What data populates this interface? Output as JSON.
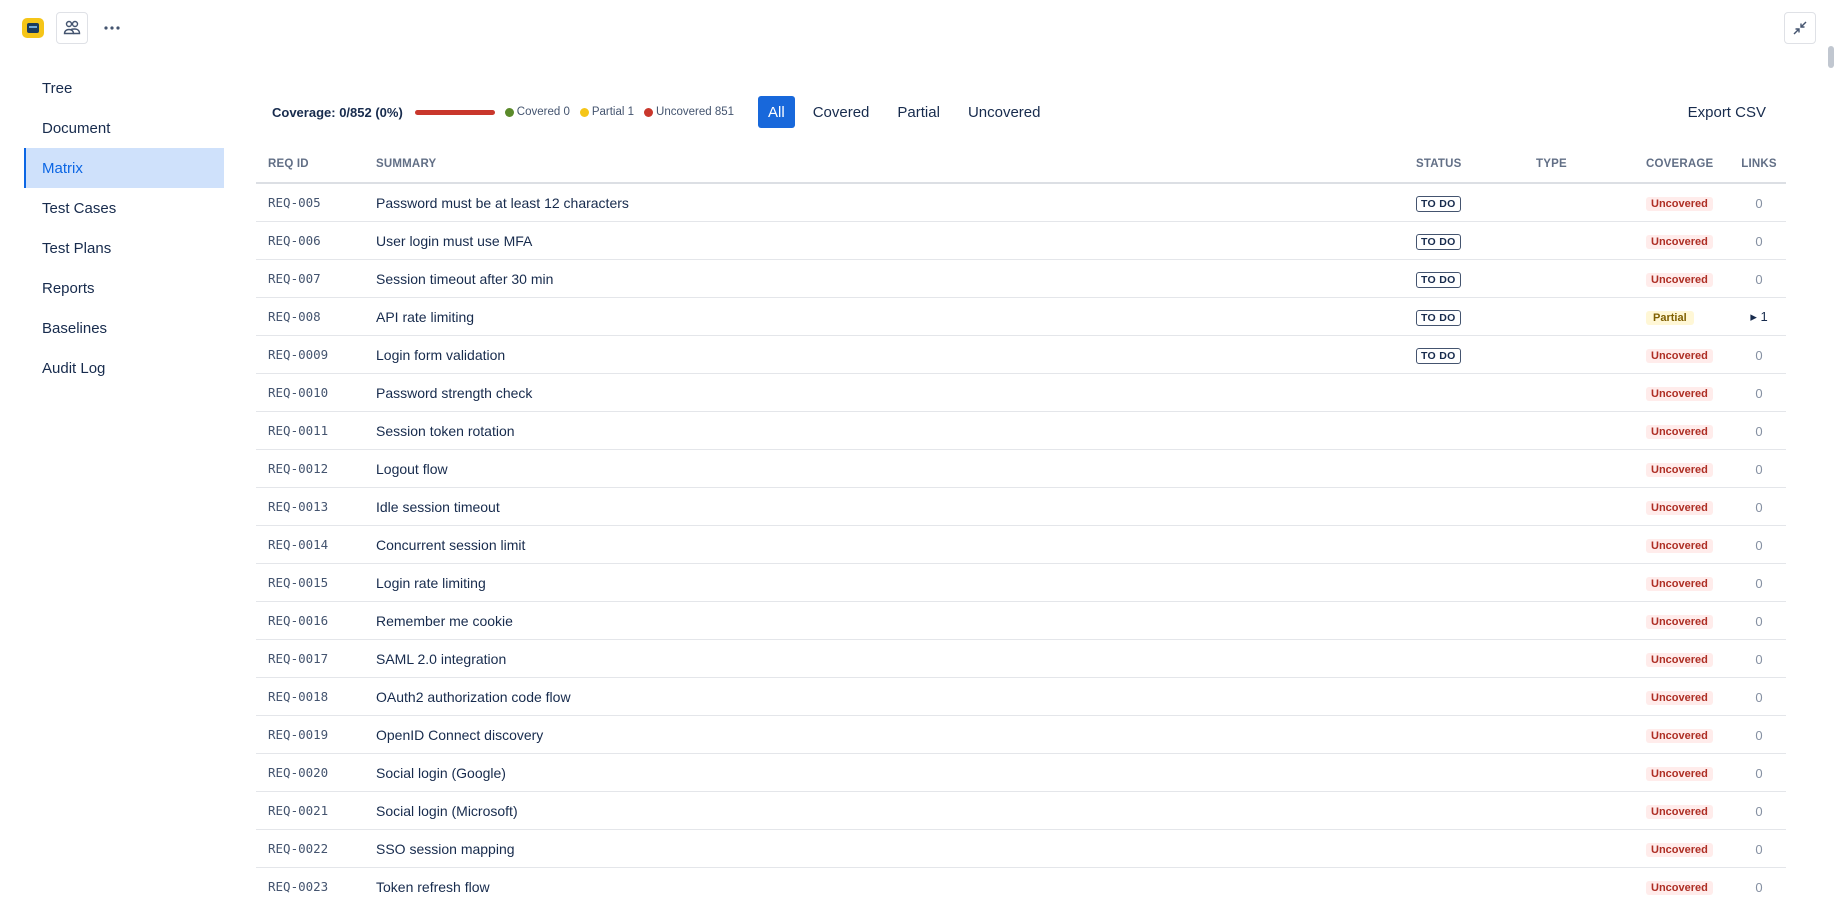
{
  "header": {
    "logo_icon": "app-logo-icon",
    "team_icon": "team-icon",
    "more_icon": "more-horizontal-icon",
    "collapse_icon": "collapse-icon"
  },
  "sidebar": {
    "items": [
      {
        "label": "Tree",
        "active": false
      },
      {
        "label": "Document",
        "active": false
      },
      {
        "label": "Matrix",
        "active": true
      },
      {
        "label": "Test Cases",
        "active": false
      },
      {
        "label": "Test Plans",
        "active": false
      },
      {
        "label": "Reports",
        "active": false
      },
      {
        "label": "Baselines",
        "active": false
      },
      {
        "label": "Audit Log",
        "active": false
      }
    ]
  },
  "toolbar": {
    "coverage_text": "Coverage: 0/852 (0%)",
    "coverage_fraction": 0,
    "legend": {
      "covered": "Covered 0",
      "partial": "Partial 1",
      "uncovered": "Uncovered 851"
    },
    "filters": [
      "All",
      "Covered",
      "Partial",
      "Uncovered"
    ],
    "active_filter": "All",
    "export_label": "Export CSV"
  },
  "colors": {
    "covered": "#5b8a2a",
    "partial": "#f5c518",
    "uncovered": "#c9372c",
    "accent": "#1868db"
  },
  "table": {
    "headers": {
      "id": "REQ ID",
      "summary": "SUMMARY",
      "status": "STATUS",
      "type": "TYPE",
      "coverage": "COVERAGE",
      "links": "LINKS"
    },
    "rows": [
      {
        "id": "REQ-005",
        "summary": "Password must be at least 12 characters",
        "status": "TO DO",
        "type": "",
        "coverage": "Uncovered",
        "links": "0"
      },
      {
        "id": "REQ-006",
        "summary": "User login must use MFA",
        "status": "TO DO",
        "type": "",
        "coverage": "Uncovered",
        "links": "0"
      },
      {
        "id": "REQ-007",
        "summary": "Session timeout after 30 min",
        "status": "TO DO",
        "type": "",
        "coverage": "Uncovered",
        "links": "0"
      },
      {
        "id": "REQ-008",
        "summary": "API rate limiting",
        "status": "TO DO",
        "type": "",
        "coverage": "Partial",
        "links": "▸ 1"
      },
      {
        "id": "REQ-0009",
        "summary": "Login form validation",
        "status": "TO DO",
        "type": "",
        "coverage": "Uncovered",
        "links": "0"
      },
      {
        "id": "REQ-0010",
        "summary": "Password strength check",
        "status": "",
        "type": "",
        "coverage": "Uncovered",
        "links": "0"
      },
      {
        "id": "REQ-0011",
        "summary": "Session token rotation",
        "status": "",
        "type": "",
        "coverage": "Uncovered",
        "links": "0"
      },
      {
        "id": "REQ-0012",
        "summary": "Logout flow",
        "status": "",
        "type": "",
        "coverage": "Uncovered",
        "links": "0"
      },
      {
        "id": "REQ-0013",
        "summary": "Idle session timeout",
        "status": "",
        "type": "",
        "coverage": "Uncovered",
        "links": "0"
      },
      {
        "id": "REQ-0014",
        "summary": "Concurrent session limit",
        "status": "",
        "type": "",
        "coverage": "Uncovered",
        "links": "0"
      },
      {
        "id": "REQ-0015",
        "summary": "Login rate limiting",
        "status": "",
        "type": "",
        "coverage": "Uncovered",
        "links": "0"
      },
      {
        "id": "REQ-0016",
        "summary": "Remember me cookie",
        "status": "",
        "type": "",
        "coverage": "Uncovered",
        "links": "0"
      },
      {
        "id": "REQ-0017",
        "summary": "SAML 2.0 integration",
        "status": "",
        "type": "",
        "coverage": "Uncovered",
        "links": "0"
      },
      {
        "id": "REQ-0018",
        "summary": "OAuth2 authorization code flow",
        "status": "",
        "type": "",
        "coverage": "Uncovered",
        "links": "0"
      },
      {
        "id": "REQ-0019",
        "summary": "OpenID Connect discovery",
        "status": "",
        "type": "",
        "coverage": "Uncovered",
        "links": "0"
      },
      {
        "id": "REQ-0020",
        "summary": "Social login (Google)",
        "status": "",
        "type": "",
        "coverage": "Uncovered",
        "links": "0"
      },
      {
        "id": "REQ-0021",
        "summary": "Social login (Microsoft)",
        "status": "",
        "type": "",
        "coverage": "Uncovered",
        "links": "0"
      },
      {
        "id": "REQ-0022",
        "summary": "SSO session mapping",
        "status": "",
        "type": "",
        "coverage": "Uncovered",
        "links": "0"
      },
      {
        "id": "REQ-0023",
        "summary": "Token refresh flow",
        "status": "",
        "type": "",
        "coverage": "Uncovered",
        "links": "0"
      }
    ]
  }
}
